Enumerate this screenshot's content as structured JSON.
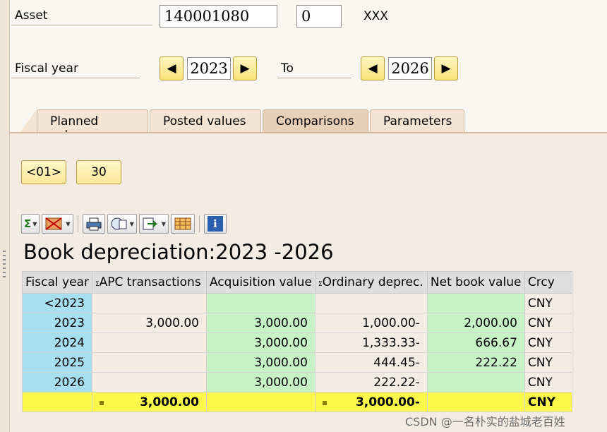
{
  "header": {
    "asset_label": "Asset",
    "asset_number": "140001080",
    "sub_number": "0",
    "asset_desc": "XXX",
    "fiscal_year_label": "Fiscal year",
    "from_year": "2023",
    "to_label": "To",
    "to_year": "2026"
  },
  "tabs": [
    {
      "label": "Planned values"
    },
    {
      "label": "Posted values"
    },
    {
      "label": "Comparisons"
    },
    {
      "label": "Parameters"
    }
  ],
  "buttons": {
    "area": "<01>",
    "area_value": "30"
  },
  "report": {
    "title": "Book depreciation:2023 -2026"
  },
  "table": {
    "columns": [
      "Fiscal year",
      "APC transactions",
      "Acquisition value",
      "Ordinary deprec.",
      "Net book value",
      "Crcy"
    ],
    "sum_marker": "Σ",
    "rows": [
      {
        "year": "<2023",
        "apc": "",
        "acq": "",
        "ord": "",
        "nbv": "",
        "crcy": "CNY"
      },
      {
        "year": "2023",
        "apc": "3,000.00",
        "acq": "3,000.00",
        "ord": "1,000.00-",
        "nbv": "2,000.00",
        "crcy": "CNY"
      },
      {
        "year": "2024",
        "apc": "",
        "acq": "3,000.00",
        "ord": "1,333.33-",
        "nbv": "666.67",
        "crcy": "CNY"
      },
      {
        "year": "2025",
        "apc": "",
        "acq": "3,000.00",
        "ord": "444.45-",
        "nbv": "222.22",
        "crcy": "CNY"
      },
      {
        "year": "2026",
        "apc": "",
        "acq": "3,000.00",
        "ord": "222.22-",
        "nbv": "",
        "crcy": "CNY"
      }
    ],
    "total": {
      "apc": "3,000.00",
      "ord": "3,000.00-",
      "crcy": "CNY"
    }
  },
  "watermark": "CSDN @一名朴实的盐城老百姓",
  "icons": {
    "prev": "◀",
    "next": "▶",
    "sum": "Σ",
    "info": "i"
  },
  "colors": {
    "year_col": "#a8dff0",
    "value_col": "#c6f2c6",
    "total_row": "#fef94a",
    "button": "#fde79a"
  }
}
